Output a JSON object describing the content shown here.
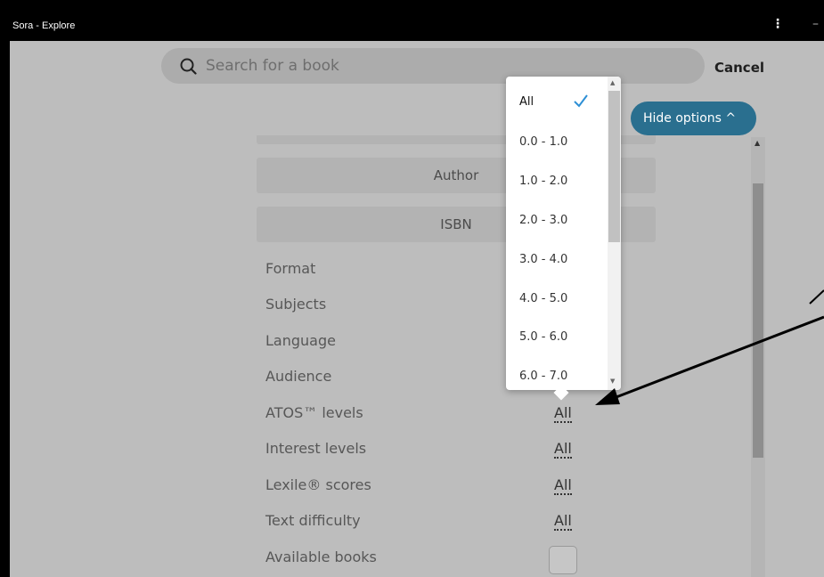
{
  "window": {
    "title": "Sora - Explore",
    "menu_glyph": "⋮",
    "min_glyph": "–"
  },
  "search": {
    "placeholder": "Search for a book",
    "cancel_label": "Cancel"
  },
  "hide_options": {
    "label": "Hide options ^"
  },
  "fields": [
    {
      "label": "Author"
    },
    {
      "label": "ISBN"
    }
  ],
  "filters": [
    {
      "label": "Format"
    },
    {
      "label": "Subjects"
    },
    {
      "label": "Language"
    },
    {
      "label": "Audience"
    },
    {
      "label": "ATOS™ levels",
      "value": "All"
    },
    {
      "label": "Interest levels",
      "value": "All"
    },
    {
      "label": "Lexile® scores",
      "value": "All"
    },
    {
      "label": "Text difficulty",
      "value": "All"
    },
    {
      "label": "Available books",
      "checked": false
    }
  ],
  "dropdown": {
    "options": [
      "All",
      "0.0 - 1.0",
      "1.0 - 2.0",
      "2.0 - 3.0",
      "3.0 - 4.0",
      "4.0 - 5.0",
      "5.0 - 6.0",
      "6.0 - 7.0"
    ],
    "selected": "All"
  },
  "colors": {
    "accent": "#2a6f8f",
    "check": "#2d8fd5"
  }
}
